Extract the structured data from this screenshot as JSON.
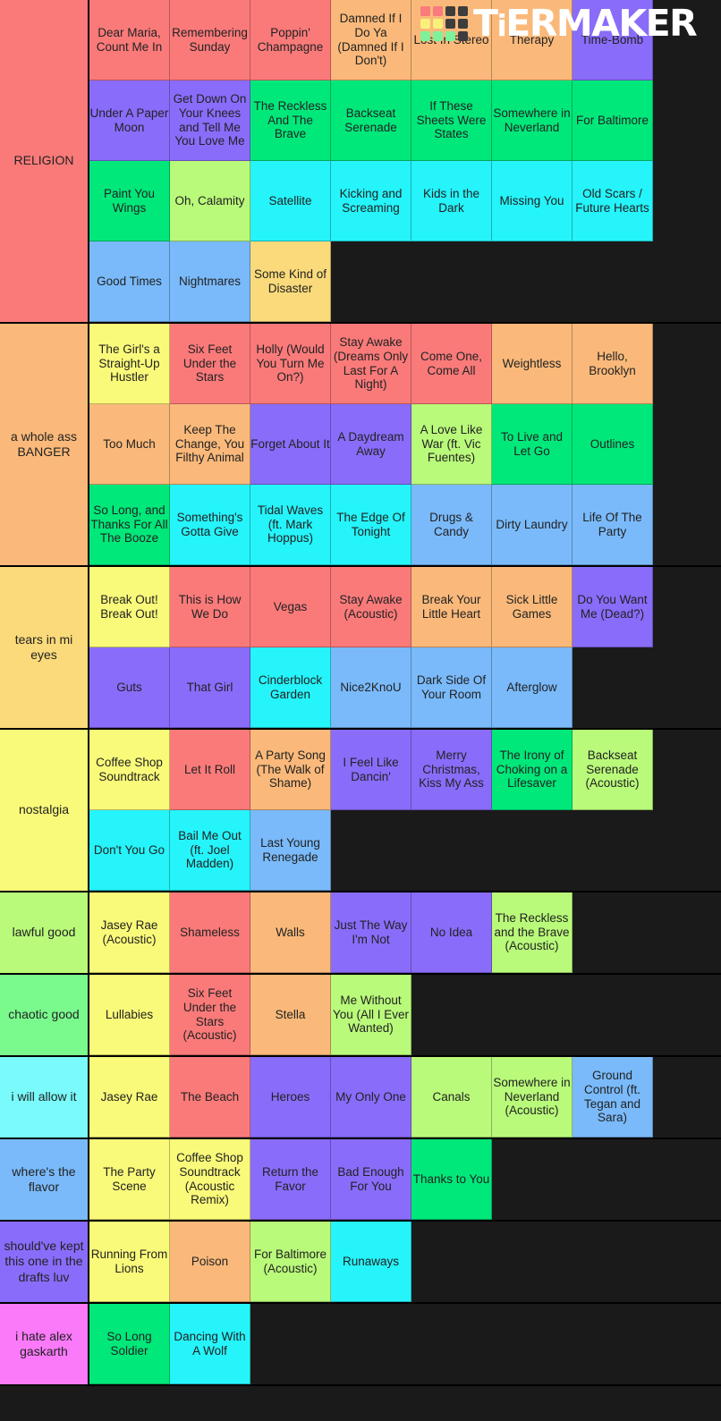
{
  "watermark": {
    "brand_text_1": "T",
    "brand_text_i": "i",
    "brand_text_2": "ERMAKER",
    "logo_name": "tiermaker-logo",
    "swatches": [
      "#f97b7b",
      "#f97b7b",
      "#3d3d3d",
      "#3d3d3d",
      "#fbf07a",
      "#fbf07a",
      "#3d3d3d",
      "#3d3d3d",
      "#7ef29a",
      "#7ef29a",
      "#7ef29a",
      "#3d3d3d"
    ]
  },
  "palette": {
    "red": "#fa7a7a",
    "orange": "#fab97a",
    "yellow": "#fada7a",
    "pale_yellow": "#fafa7a",
    "lime": "#b9fa7a",
    "green": "#7afa8d",
    "spring": "#00e87a",
    "cyan": "#25f4fa",
    "light_cyan": "#7afafa",
    "blue": "#7abafa",
    "purple": "#8a6cfa",
    "violet": "#9a7afa",
    "pink": "#fa7afa"
  },
  "tiers": [
    {
      "label": "RELIGION",
      "label_color": "#fa7a7a",
      "items": [
        {
          "text": "Dear Maria, Count Me In",
          "color": "#fa7a7a"
        },
        {
          "text": "Remembering Sunday",
          "color": "#fa7a7a"
        },
        {
          "text": "Poppin' Champagne",
          "color": "#fa7a7a"
        },
        {
          "text": "Damned If I Do Ya (Damned If I Don't)",
          "color": "#fab97a"
        },
        {
          "text": "Lost In Stereo",
          "color": "#fab97a"
        },
        {
          "text": "Therapy",
          "color": "#fab97a"
        },
        {
          "text": "Time-Bomb",
          "color": "#8a6cfa"
        },
        {
          "text": "Under A Paper Moon",
          "color": "#8a6cfa"
        },
        {
          "text": "Get Down On Your Knees and Tell Me You Love Me",
          "color": "#8a6cfa"
        },
        {
          "text": "The Reckless And The Brave",
          "color": "#00e87a"
        },
        {
          "text": "Backseat Serenade",
          "color": "#00e87a"
        },
        {
          "text": "If These Sheets Were States",
          "color": "#00e87a"
        },
        {
          "text": "Somewhere in Neverland",
          "color": "#00e87a"
        },
        {
          "text": "For Baltimore",
          "color": "#00e87a"
        },
        {
          "text": "Paint You Wings",
          "color": "#00e87a"
        },
        {
          "text": "Oh, Calamity",
          "color": "#b9fa7a"
        },
        {
          "text": "Satellite",
          "color": "#25f4fa"
        },
        {
          "text": "Kicking and Screaming",
          "color": "#25f4fa"
        },
        {
          "text": "Kids in the Dark",
          "color": "#25f4fa"
        },
        {
          "text": "Missing You",
          "color": "#25f4fa"
        },
        {
          "text": "Old Scars / Future Hearts",
          "color": "#25f4fa"
        },
        {
          "text": "Good Times",
          "color": "#7abafa"
        },
        {
          "text": "Nightmares",
          "color": "#7abafa"
        },
        {
          "text": "Some Kind of Disaster",
          "color": "#fada7a"
        }
      ]
    },
    {
      "label": "a whole ass BANGER",
      "label_color": "#fab97a",
      "items": [
        {
          "text": "The Girl's a Straight-Up Hustler",
          "color": "#fafa7a"
        },
        {
          "text": "Six Feet Under the Stars",
          "color": "#fa7a7a"
        },
        {
          "text": "Holly (Would You Turn Me On?)",
          "color": "#fa7a7a"
        },
        {
          "text": "Stay Awake (Dreams Only Last For A Night)",
          "color": "#fa7a7a"
        },
        {
          "text": "Come One, Come All",
          "color": "#fa7a7a"
        },
        {
          "text": "Weightless",
          "color": "#fab97a"
        },
        {
          "text": "Hello, Brooklyn",
          "color": "#fab97a"
        },
        {
          "text": "Too Much",
          "color": "#fab97a"
        },
        {
          "text": "Keep The Change, You Filthy Animal",
          "color": "#fab97a"
        },
        {
          "text": "Forget About It",
          "color": "#8a6cfa"
        },
        {
          "text": "A Daydream Away",
          "color": "#8a6cfa"
        },
        {
          "text": "A Love Like War (ft. Vic Fuentes)",
          "color": "#b9fa7a"
        },
        {
          "text": "To Live and Let Go",
          "color": "#00e87a"
        },
        {
          "text": "Outlines",
          "color": "#00e87a"
        },
        {
          "text": "So Long, and Thanks For All The Booze",
          "color": "#00e87a"
        },
        {
          "text": "Something's Gotta Give",
          "color": "#25f4fa"
        },
        {
          "text": "Tidal Waves (ft. Mark Hoppus)",
          "color": "#25f4fa"
        },
        {
          "text": "The Edge Of Tonight",
          "color": "#25f4fa"
        },
        {
          "text": "Drugs & Candy",
          "color": "#7abafa"
        },
        {
          "text": "Dirty Laundry",
          "color": "#7abafa"
        },
        {
          "text": "Life Of The Party",
          "color": "#7abafa"
        }
      ]
    },
    {
      "label": "tears in mi eyes",
      "label_color": "#fada7a",
      "items": [
        {
          "text": "Break Out! Break Out!",
          "color": "#fafa7a"
        },
        {
          "text": "This is How We Do",
          "color": "#fa7a7a"
        },
        {
          "text": "Vegas",
          "color": "#fa7a7a"
        },
        {
          "text": "Stay Awake (Acoustic)",
          "color": "#fa7a7a"
        },
        {
          "text": "Break Your Little Heart",
          "color": "#fab97a"
        },
        {
          "text": "Sick Little Games",
          "color": "#fab97a"
        },
        {
          "text": "Do You Want Me (Dead?)",
          "color": "#8a6cfa"
        },
        {
          "text": "Guts",
          "color": "#8a6cfa"
        },
        {
          "text": "That Girl",
          "color": "#8a6cfa"
        },
        {
          "text": "Cinderblock Garden",
          "color": "#25f4fa"
        },
        {
          "text": "Nice2KnoU",
          "color": "#7abafa"
        },
        {
          "text": "Dark Side Of Your Room",
          "color": "#7abafa"
        },
        {
          "text": "Afterglow",
          "color": "#7abafa"
        }
      ]
    },
    {
      "label": "nostalgia",
      "label_color": "#fafa7a",
      "items": [
        {
          "text": "Coffee Shop Soundtrack",
          "color": "#fafa7a"
        },
        {
          "text": "Let It Roll",
          "color": "#fa7a7a"
        },
        {
          "text": "A Party Song (The Walk of Shame)",
          "color": "#fab97a"
        },
        {
          "text": "I Feel Like Dancin'",
          "color": "#8a6cfa"
        },
        {
          "text": "Merry Christmas, Kiss My Ass",
          "color": "#8a6cfa"
        },
        {
          "text": "The Irony of Choking on a Lifesaver",
          "color": "#00e87a"
        },
        {
          "text": "Backseat Serenade (Acoustic)",
          "color": "#b9fa7a"
        },
        {
          "text": "Don't You Go",
          "color": "#25f4fa"
        },
        {
          "text": "Bail Me Out (ft. Joel Madden)",
          "color": "#25f4fa"
        },
        {
          "text": "Last Young Renegade",
          "color": "#7abafa"
        }
      ]
    },
    {
      "label": "lawful good",
      "label_color": "#b9fa7a",
      "items": [
        {
          "text": "Jasey Rae (Acoustic)",
          "color": "#fafa7a"
        },
        {
          "text": "Shameless",
          "color": "#fa7a7a"
        },
        {
          "text": "Walls",
          "color": "#fab97a"
        },
        {
          "text": "Just The Way I'm Not",
          "color": "#8a6cfa"
        },
        {
          "text": "No Idea",
          "color": "#8a6cfa"
        },
        {
          "text": "The Reckless and the Brave (Acoustic)",
          "color": "#b9fa7a"
        }
      ]
    },
    {
      "label": "chaotic good",
      "label_color": "#7afa8d",
      "items": [
        {
          "text": "Lullabies",
          "color": "#fafa7a"
        },
        {
          "text": "Six Feet Under the Stars (Acoustic)",
          "color": "#fa7a7a"
        },
        {
          "text": "Stella",
          "color": "#fab97a"
        },
        {
          "text": "Me Without You (All I Ever Wanted)",
          "color": "#b9fa7a"
        }
      ]
    },
    {
      "label": "i will allow it",
      "label_color": "#7afafa",
      "items": [
        {
          "text": "Jasey Rae",
          "color": "#fafa7a"
        },
        {
          "text": "The Beach",
          "color": "#fa7a7a"
        },
        {
          "text": "Heroes",
          "color": "#8a6cfa"
        },
        {
          "text": "My Only One",
          "color": "#8a6cfa"
        },
        {
          "text": "Canals",
          "color": "#b9fa7a"
        },
        {
          "text": "Somewhere in Neverland (Acoustic)",
          "color": "#b9fa7a"
        },
        {
          "text": "Ground Control (ft. Tegan and Sara)",
          "color": "#7abafa"
        }
      ]
    },
    {
      "label": "where's the flavor",
      "label_color": "#7abafa",
      "items": [
        {
          "text": "The Party Scene",
          "color": "#fafa7a"
        },
        {
          "text": "Coffee Shop Soundtrack (Acoustic Remix)",
          "color": "#fafa7a"
        },
        {
          "text": "Return the Favor",
          "color": "#8a6cfa"
        },
        {
          "text": "Bad Enough For You",
          "color": "#8a6cfa"
        },
        {
          "text": "Thanks to You",
          "color": "#00e87a"
        }
      ]
    },
    {
      "label": "should've kept this one in the drafts luv",
      "label_color": "#8a6cfa",
      "items": [
        {
          "text": "Running From Lions",
          "color": "#fafa7a"
        },
        {
          "text": "Poison",
          "color": "#fab97a"
        },
        {
          "text": "For Baltimore (Acoustic)",
          "color": "#b9fa7a"
        },
        {
          "text": "Runaways",
          "color": "#25f4fa"
        }
      ]
    },
    {
      "label": "i hate alex gaskarth",
      "label_color": "#fa7afa",
      "items": [
        {
          "text": "So Long Soldier",
          "color": "#00e87a"
        },
        {
          "text": "Dancing With A Wolf",
          "color": "#25f4fa"
        }
      ]
    }
  ]
}
